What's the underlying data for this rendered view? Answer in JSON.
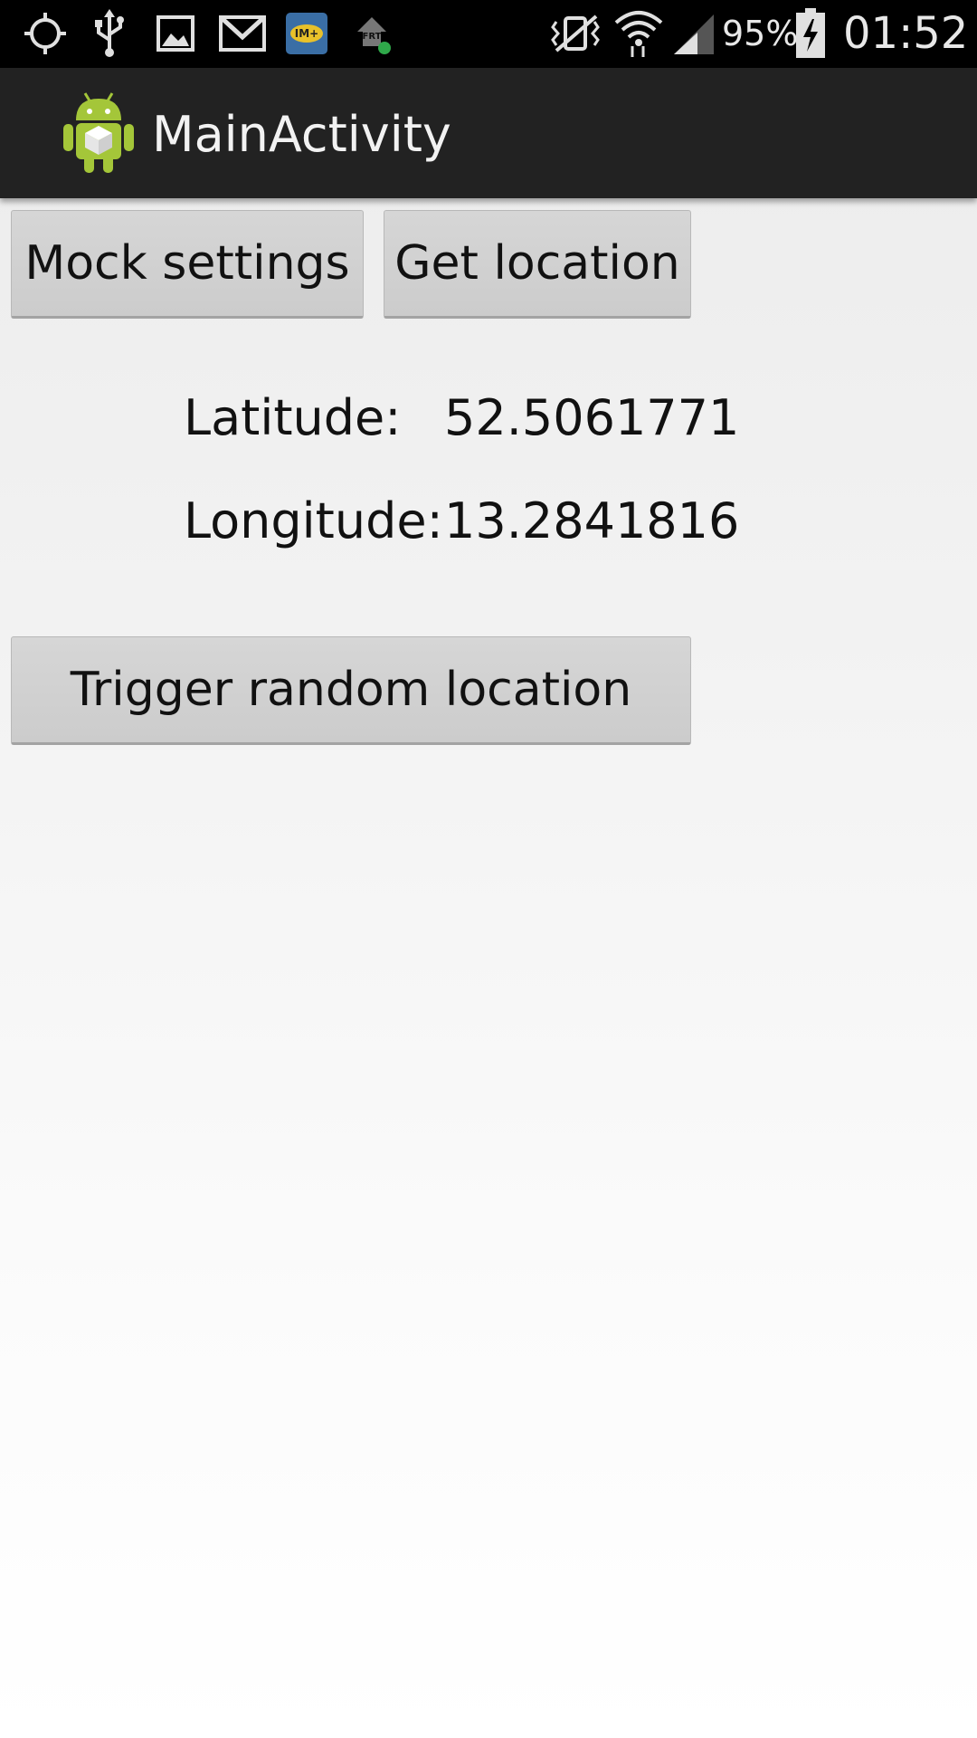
{
  "status_bar": {
    "icons_left": [
      "gps-icon",
      "usb-icon",
      "gallery-icon",
      "gmail-icon",
      "im-plus-icon",
      "app-notification-icon"
    ],
    "icons_right": [
      "vibrate-icon",
      "wifi-icon",
      "signal-icon",
      "battery-charging-icon"
    ],
    "battery_percent": "95%",
    "time": "01:52"
  },
  "action_bar": {
    "app_icon": "android-app-icon",
    "title": "MainActivity"
  },
  "buttons": {
    "mock_settings": "Mock settings",
    "get_location": "Get location",
    "trigger_random": "Trigger random location"
  },
  "location": {
    "latitude_label": "Latitude:",
    "latitude_value": "52.5061771",
    "longitude_label": "Longitude:",
    "longitude_value": "13.2841816"
  },
  "colors": {
    "status_bar_bg": "#000000",
    "action_bar_bg": "#222222",
    "button_bg": "#d0d0d0",
    "android_green": "#a4c639"
  }
}
